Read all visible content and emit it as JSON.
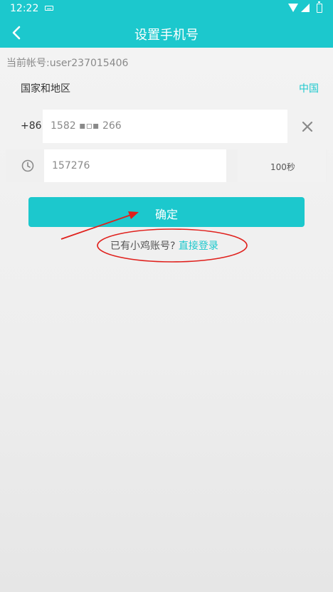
{
  "status_bar": {
    "time": "12:22",
    "icons": [
      "keyboard-icon",
      "wifi-icon",
      "signal-icon",
      "battery-icon"
    ]
  },
  "app_bar": {
    "title": "设置手机号",
    "back_icon": "chevron-left-icon"
  },
  "account": {
    "line": "当前帐号:user237015406"
  },
  "region": {
    "label": "国家和地区",
    "value": "中国"
  },
  "phone": {
    "country_code": "+86",
    "value": "1582 ▪▫▪ 266",
    "clear_icon": "close-icon"
  },
  "verification": {
    "icon": "clock-icon",
    "code": "157276",
    "countdown": "100秒"
  },
  "confirm": {
    "label": "确定"
  },
  "login": {
    "question": "已有小鸡账号?",
    "link": "直接登录"
  },
  "colors": {
    "accent": "#1cc8cd",
    "annotation": "#e0201c",
    "background": "#f0f0f0"
  }
}
